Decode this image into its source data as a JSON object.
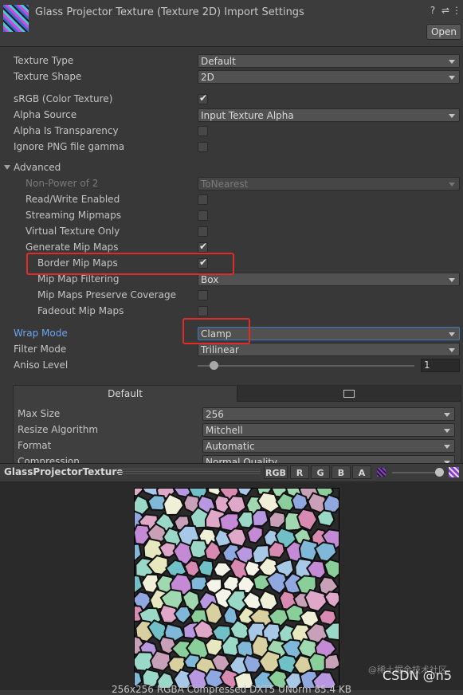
{
  "header": {
    "title": "Glass Projector Texture (Texture 2D) Import Settings",
    "open_label": "Open",
    "icons": [
      "help-icon",
      "presets-icon",
      "more-icon"
    ]
  },
  "settings": {
    "texture_type": {
      "label": "Texture Type",
      "value": "Default"
    },
    "texture_shape": {
      "label": "Texture Shape",
      "value": "2D"
    },
    "srgb": {
      "label": "sRGB (Color Texture)",
      "checked": true
    },
    "alpha_source": {
      "label": "Alpha Source",
      "value": "Input Texture Alpha"
    },
    "alpha_transparency": {
      "label": "Alpha Is Transparency",
      "checked": false
    },
    "ignore_png_gamma": {
      "label": "Ignore PNG file gamma",
      "checked": false
    },
    "advanced": {
      "label": "Advanced"
    },
    "non_power": {
      "label": "Non-Power of 2",
      "value": "ToNearest"
    },
    "read_write": {
      "label": "Read/Write Enabled",
      "checked": false
    },
    "streaming_mipmaps": {
      "label": "Streaming Mipmaps",
      "checked": false
    },
    "virtual_texture": {
      "label": "Virtual Texture Only",
      "checked": false
    },
    "generate_mipmaps": {
      "label": "Generate Mip Maps",
      "checked": true
    },
    "border_mipmaps": {
      "label": "Border Mip Maps",
      "checked": true
    },
    "mipmap_filtering": {
      "label": "Mip Map Filtering",
      "value": "Box"
    },
    "mipmaps_coverage": {
      "label": "Mip Maps Preserve Coverage",
      "checked": false
    },
    "fadeout_mipmaps": {
      "label": "Fadeout Mip Maps",
      "checked": false
    },
    "wrap_mode": {
      "label": "Wrap Mode",
      "value": "Clamp"
    },
    "filter_mode": {
      "label": "Filter Mode",
      "value": "Trilinear"
    },
    "aniso_level": {
      "label": "Aniso Level",
      "value": "1",
      "slider_fraction": 0.0
    }
  },
  "platform": {
    "tab_default": "Default",
    "tab_icon": "monitor-icon",
    "max_size": {
      "label": "Max Size",
      "value": "256"
    },
    "resize_algorithm": {
      "label": "Resize Algorithm",
      "value": "Mitchell"
    },
    "format": {
      "label": "Format",
      "value": "Automatic"
    },
    "compression": {
      "label": "Compression",
      "value": "Normal Quality"
    }
  },
  "preview": {
    "name": "GlassProjectorTexture",
    "channels": [
      "RGB",
      "R",
      "G",
      "B",
      "A"
    ],
    "info": "256x256  RGBA Compressed DXT5 UNorm  85.4 KB"
  },
  "watermark": {
    "line1": "@稀土掘金技术社区",
    "line2": "CSDN @n5"
  },
  "colors": {
    "highlight_red": "#e12b2b",
    "focus_blue": "#3a79bb",
    "label_blue": "#6aa6f0"
  }
}
